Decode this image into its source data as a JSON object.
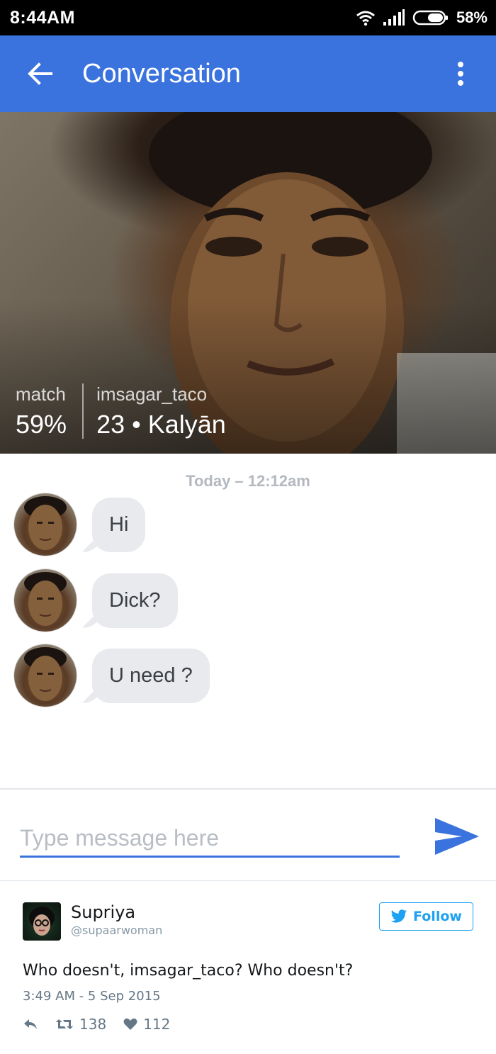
{
  "status_bar": {
    "time": "8:44AM",
    "battery": "58%",
    "icons": [
      "wifi-icon",
      "signal-icon",
      "battery-icon"
    ]
  },
  "app_bar": {
    "title": "Conversation",
    "back_icon": "arrow-left-icon",
    "menu_icon": "more-vert-icon",
    "color": "#3a73dd"
  },
  "profile": {
    "match_label": "match",
    "match_value": "59%",
    "username": "imsagar_taco",
    "details": "23 • Kalyān"
  },
  "chat": {
    "date": "Today – 12:12am",
    "messages": [
      {
        "text": "Hi"
      },
      {
        "text": "Dick?"
      },
      {
        "text": "U need ?"
      }
    ]
  },
  "composer": {
    "placeholder": "Type message here",
    "send_icon": "send-icon"
  },
  "tweet": {
    "name": "Supriya",
    "handle": "@supaarwoman",
    "follow_label": "Follow",
    "text": "Who doesn't, imsagar_taco? Who doesn't?",
    "timestamp": "3:49 AM - 5 Sep 2015",
    "retweets": "138",
    "likes": "112",
    "accent": "#1da1f2"
  }
}
